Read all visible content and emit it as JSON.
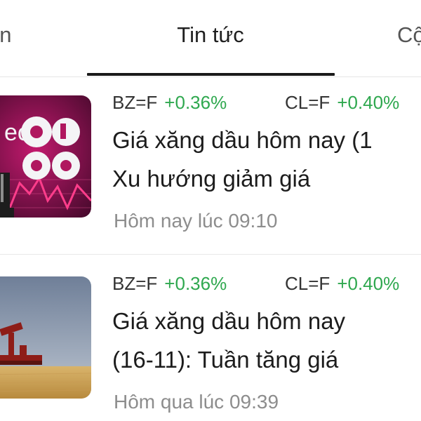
{
  "tabs": {
    "left_label": "an",
    "active_label": "Tin tức",
    "right_label": "Cộ"
  },
  "news": [
    {
      "tickers": [
        {
          "symbol": "BZ=F",
          "change": "+0.36%"
        },
        {
          "symbol": "CL=F",
          "change": "+0.40%"
        }
      ],
      "headline_line1": "Giá xăng dầu hôm nay (1",
      "headline_line2": "Xu hướng giảm giá",
      "time": "Hôm nay lúc 09:10",
      "thumbnail_text": "ec"
    },
    {
      "tickers": [
        {
          "symbol": "BZ=F",
          "change": "+0.36%"
        },
        {
          "symbol": "CL=F",
          "change": "+0.40%"
        }
      ],
      "headline_line1": "Giá xăng dầu hôm nay",
      "headline_line2": "(16-11): Tuần tăng giá",
      "time": "Hôm qua lúc 09:39"
    }
  ],
  "colors": {
    "positive": "#2fa84f",
    "tab_indicator": "#1a1a1a",
    "muted": "#8d8d8d"
  }
}
